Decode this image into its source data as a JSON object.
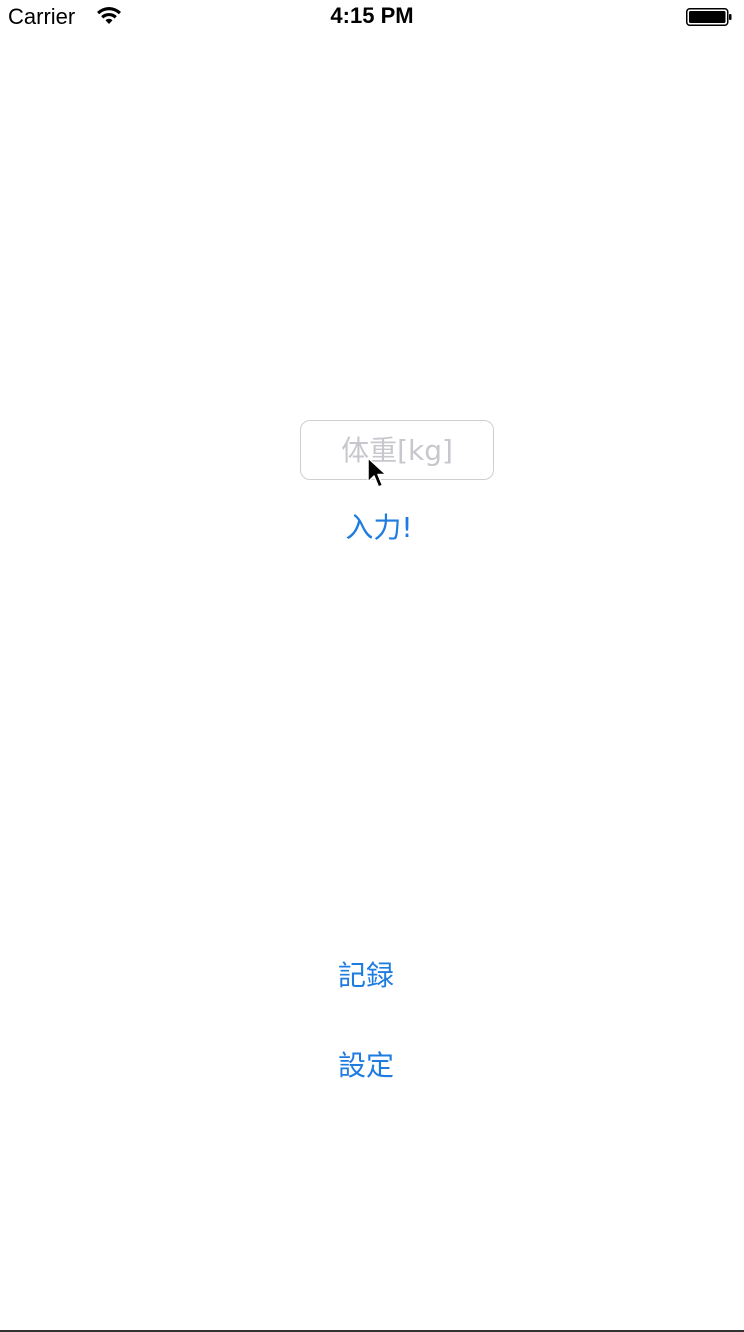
{
  "status_bar": {
    "carrier": "Carrier",
    "time": "4:15 PM",
    "wifi_icon": "wifi-icon",
    "battery_icon": "battery-icon"
  },
  "form": {
    "weight_placeholder": "体重[kg]",
    "weight_value": "",
    "submit_label": "入力!"
  },
  "nav": {
    "record_label": "記録",
    "settings_label": "設定"
  },
  "colors": {
    "accent": "#1e7be0",
    "placeholder": "#c7c7cd",
    "field_border": "#cfcfcf"
  }
}
